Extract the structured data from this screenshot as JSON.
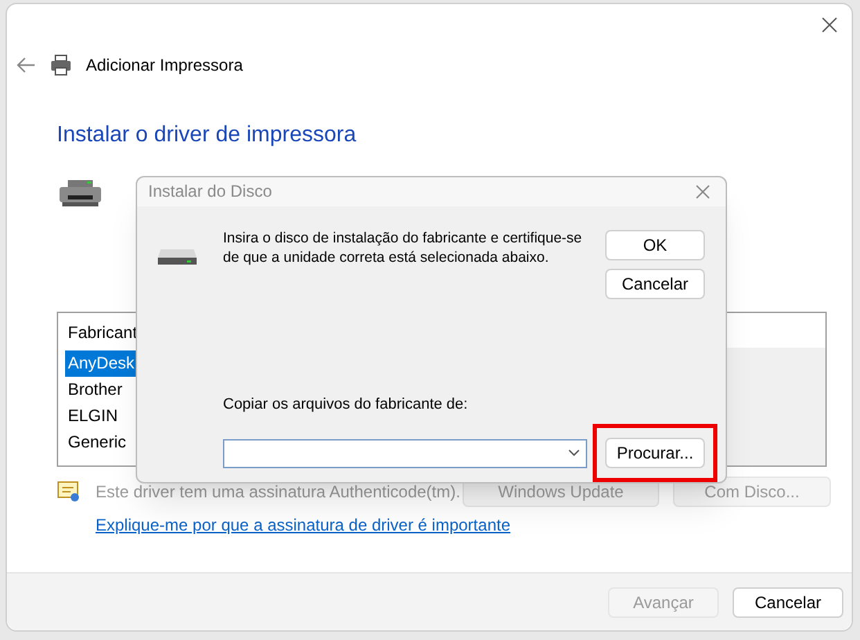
{
  "window": {
    "title": "Adicionar Impressora"
  },
  "heading": "Instalar o driver de impressora",
  "manufacturer_list": {
    "header": "Fabricant",
    "items": [
      {
        "label": "AnyDesk",
        "selected": true
      },
      {
        "label": "Brother",
        "selected": false
      },
      {
        "label": "ELGIN",
        "selected": false
      },
      {
        "label": "Generic",
        "selected": false
      }
    ]
  },
  "signature_note": {
    "text": "Este driver tem uma assinatura Authenticode(tm).",
    "disabled": true
  },
  "side_buttons": [
    {
      "label": "Windows Update",
      "disabled": true
    },
    {
      "label": "Com Disco...",
      "disabled": true
    }
  ],
  "link": "Explique-me por que a assinatura de driver é importante",
  "footer_buttons": [
    {
      "label": "Avançar",
      "disabled": true
    },
    {
      "label": "Cancelar",
      "disabled": false
    }
  ],
  "dialog": {
    "title": "Instalar do Disco",
    "message": "Insira o disco de instalação do fabricante e certifique-se de que a unidade correta está selecionada abaixo.",
    "buttons": [
      {
        "label": "OK"
      },
      {
        "label": "Cancelar"
      }
    ],
    "copy_label": "Copiar os arquivos do fabricante de:",
    "browse_button": {
      "label": "Procurar...",
      "highlighted": true
    }
  }
}
